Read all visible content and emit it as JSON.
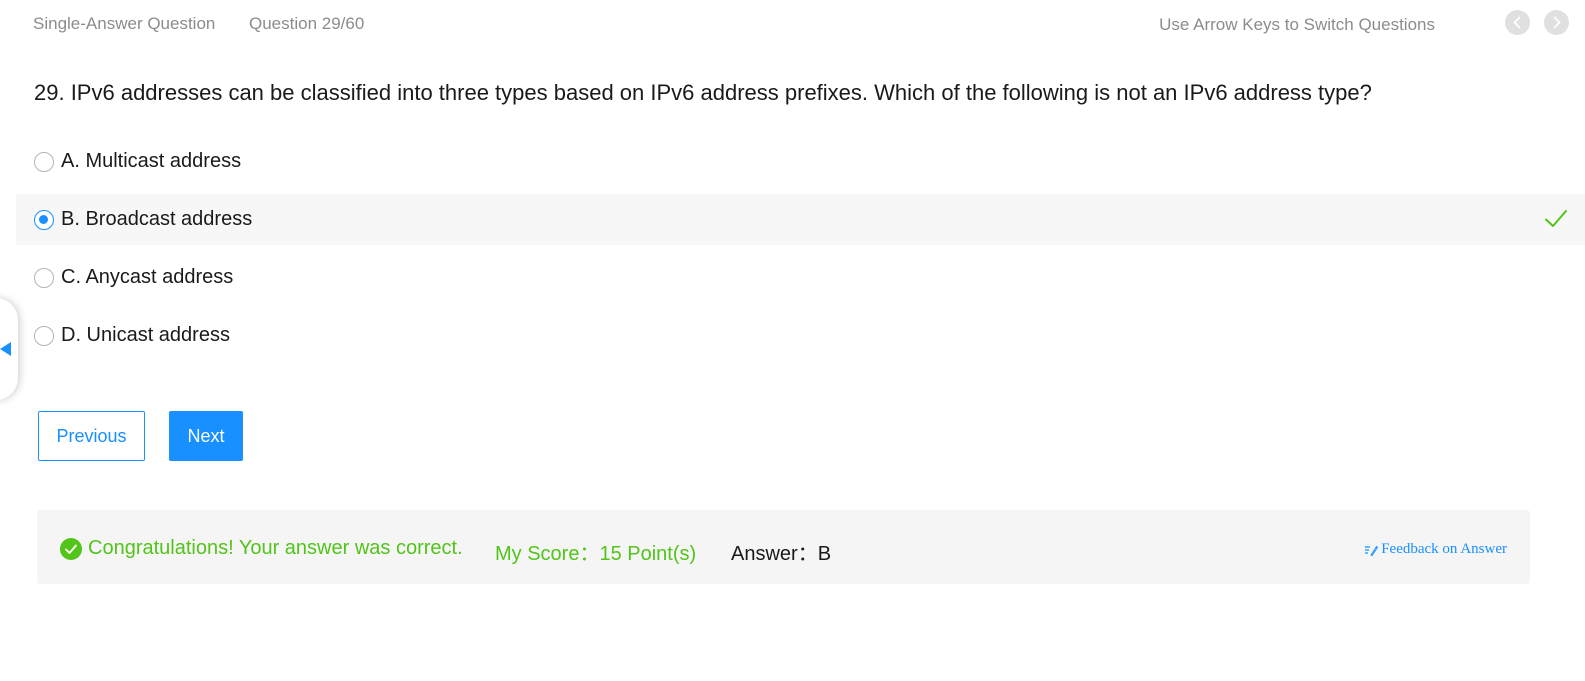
{
  "header": {
    "question_type": "Single-Answer Question",
    "question_counter": "Question 29/60",
    "nav_hint": "Use Arrow Keys to Switch Questions",
    "prev_icon": "chevron-left-icon",
    "next_icon": "chevron-right-icon"
  },
  "question": {
    "text": "29. IPv6 addresses can be classified into three types based on IPv6 address prefixes. Which of the following is not an IPv6 address type?"
  },
  "options": [
    {
      "label": "A. Multicast address",
      "selected": false
    },
    {
      "label": "B. Broadcast address",
      "selected": true,
      "correct": true
    },
    {
      "label": "C. Anycast address",
      "selected": false
    },
    {
      "label": "D. Unicast address",
      "selected": false
    }
  ],
  "buttons": {
    "previous": "Previous",
    "next": "Next"
  },
  "result": {
    "message": "Congratulations! Your answer was correct.",
    "score_label": "My Score：",
    "score_value": "15 Point(s)",
    "answer_label": "Answer：",
    "answer_value": "B",
    "feedback_link": "Feedback on Answer"
  },
  "colors": {
    "accent": "#1890ff",
    "success": "#52c41a",
    "muted_text": "#8c8c8c",
    "result_bg": "#f5f5f5"
  }
}
